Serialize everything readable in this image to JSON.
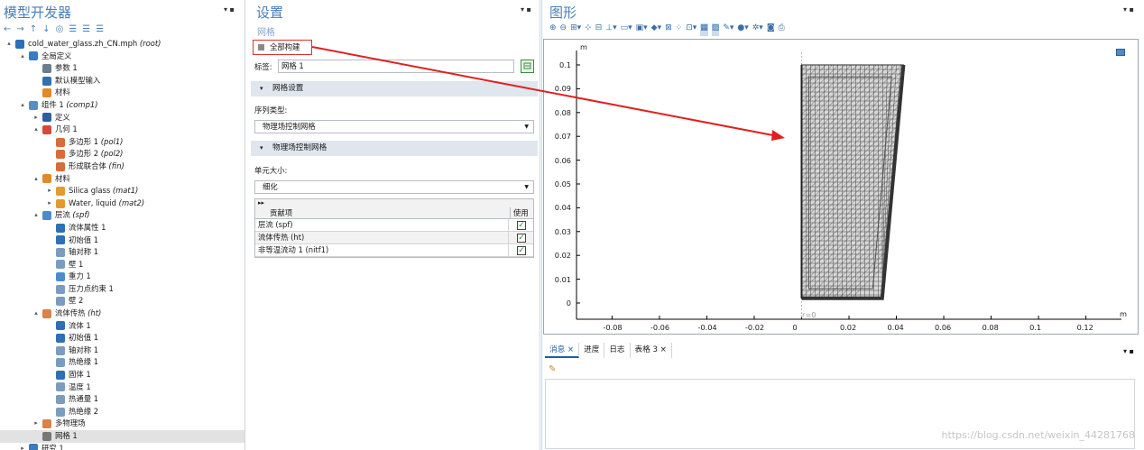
{
  "model_builder": {
    "title": "模型开发器",
    "toolbar": [
      "←",
      "→",
      "↑",
      "↓",
      "◎",
      "☰",
      "☰",
      "☰"
    ],
    "tree": [
      {
        "indent": 0,
        "toggle": "▴",
        "icon": "globe-icon",
        "color": "#2c6fb8",
        "label": "cold_water_glass.zh_CN.mph",
        "tag": "(root)"
      },
      {
        "indent": 1,
        "toggle": "▴",
        "icon": "global-defs-icon",
        "color": "#3a7abf",
        "label": "全局定义",
        "tag": ""
      },
      {
        "indent": 2,
        "toggle": "",
        "icon": "parameters-icon",
        "color": "#6b7c8e",
        "label": "参数 1",
        "tag": ""
      },
      {
        "indent": 2,
        "toggle": "",
        "icon": "model-input-icon",
        "color": "#2f6fb3",
        "label": "默认模型输入",
        "tag": ""
      },
      {
        "indent": 2,
        "toggle": "",
        "icon": "materials-icon",
        "color": "#e08a2a",
        "label": "材料",
        "tag": ""
      },
      {
        "indent": 1,
        "toggle": "▴",
        "icon": "component-icon",
        "color": "#5b8dbd",
        "label": "组件 1",
        "tag": "(comp1)"
      },
      {
        "indent": 2,
        "toggle": "▸",
        "icon": "definitions-icon",
        "color": "#2c5fa0",
        "label": "定义",
        "tag": ""
      },
      {
        "indent": 2,
        "toggle": "▴",
        "icon": "geometry-icon",
        "color": "#d34a3c",
        "label": "几何 1",
        "tag": ""
      },
      {
        "indent": 3,
        "toggle": "",
        "icon": "polygon-icon",
        "color": "#d86b3a",
        "label": "多边形 1",
        "tag": "(pol1)"
      },
      {
        "indent": 3,
        "toggle": "",
        "icon": "polygon-icon",
        "color": "#d86b3a",
        "label": "多边形 2",
        "tag": "(pol2)"
      },
      {
        "indent": 3,
        "toggle": "",
        "icon": "form-union-icon",
        "color": "#d86b3a",
        "label": "形成联合体",
        "tag": "(fin)"
      },
      {
        "indent": 2,
        "toggle": "▴",
        "icon": "materials-icon",
        "color": "#e08a2a",
        "label": "材料",
        "tag": ""
      },
      {
        "indent": 3,
        "toggle": "▸",
        "icon": "material-icon",
        "color": "#e59a2f",
        "label": "Silica glass",
        "tag": "(mat1)"
      },
      {
        "indent": 3,
        "toggle": "▸",
        "icon": "material-icon",
        "color": "#e59a2f",
        "label": "Water, liquid",
        "tag": "(mat2)"
      },
      {
        "indent": 2,
        "toggle": "▴",
        "icon": "laminar-flow-icon",
        "color": "#4d8ccc",
        "label": "层流",
        "tag": "(spf)"
      },
      {
        "indent": 3,
        "toggle": "",
        "icon": "fluid-props-icon",
        "color": "#2f6fb3",
        "label": "流体属性 1",
        "tag": ""
      },
      {
        "indent": 3,
        "toggle": "",
        "icon": "initial-values-icon",
        "color": "#2f6fb3",
        "label": "初始值 1",
        "tag": ""
      },
      {
        "indent": 3,
        "toggle": "",
        "icon": "axial-symmetry-icon",
        "color": "#7b9cbf",
        "label": "轴对称 1",
        "tag": ""
      },
      {
        "indent": 3,
        "toggle": "",
        "icon": "wall-icon",
        "color": "#7b9cbf",
        "label": "壁 1",
        "tag": ""
      },
      {
        "indent": 3,
        "toggle": "",
        "icon": "gravity-icon",
        "color": "#4d8ccc",
        "label": "重力 1",
        "tag": ""
      },
      {
        "indent": 3,
        "toggle": "",
        "icon": "pressure-point-icon",
        "color": "#7b9cbf",
        "label": "压力点约束 1",
        "tag": ""
      },
      {
        "indent": 3,
        "toggle": "",
        "icon": "wall-icon",
        "color": "#7b9cbf",
        "label": "壁 2",
        "tag": ""
      },
      {
        "indent": 2,
        "toggle": "▴",
        "icon": "heat-transfer-icon",
        "color": "#d9834a",
        "label": "流体传热",
        "tag": "(ht)"
      },
      {
        "indent": 3,
        "toggle": "",
        "icon": "fluid-icon",
        "color": "#2f6fb3",
        "label": "流体 1",
        "tag": ""
      },
      {
        "indent": 3,
        "toggle": "",
        "icon": "initial-values-icon",
        "color": "#2f6fb3",
        "label": "初始值 1",
        "tag": ""
      },
      {
        "indent": 3,
        "toggle": "",
        "icon": "axial-symmetry-icon",
        "color": "#7b9cbf",
        "label": "轴对称 1",
        "tag": ""
      },
      {
        "indent": 3,
        "toggle": "",
        "icon": "insulation-icon",
        "color": "#7b9cbf",
        "label": "热绝缘 1",
        "tag": ""
      },
      {
        "indent": 3,
        "toggle": "",
        "icon": "solid-icon",
        "color": "#2f6fb3",
        "label": "固体 1",
        "tag": ""
      },
      {
        "indent": 3,
        "toggle": "",
        "icon": "temperature-icon",
        "color": "#7b9cbf",
        "label": "温度 1",
        "tag": ""
      },
      {
        "indent": 3,
        "toggle": "",
        "icon": "heat-flux-icon",
        "color": "#7b9cbf",
        "label": "热通量 1",
        "tag": ""
      },
      {
        "indent": 3,
        "toggle": "",
        "icon": "insulation-icon",
        "color": "#7b9cbf",
        "label": "热绝缘 2",
        "tag": ""
      },
      {
        "indent": 2,
        "toggle": "▸",
        "icon": "multiphysics-icon",
        "color": "#d9834a",
        "label": "多物理场",
        "tag": ""
      },
      {
        "indent": 2,
        "toggle": "",
        "icon": "mesh-icon",
        "color": "#777777",
        "label": "网格 1",
        "tag": "",
        "selected": true
      },
      {
        "indent": 1,
        "toggle": "▸",
        "icon": "study-icon",
        "color": "#3a7abf",
        "label": "研究 1",
        "tag": ""
      }
    ]
  },
  "settings": {
    "title": "设置",
    "subtitle": "网格",
    "build_all": "全部构建",
    "label_caption": "标签:",
    "label_value": "网格 1",
    "mesh_settings_header": "网格设置",
    "sequence_type_label": "序列类型:",
    "sequence_type_value": "物理场控制网格",
    "physics_mesh_header": "物理场控制网格",
    "element_size_label": "单元大小:",
    "element_size_value": "细化",
    "table": {
      "col_contrib": "贡献项",
      "col_use": "使用",
      "rows": [
        {
          "name": "层流 (spf)",
          "checked": true
        },
        {
          "name": "流体传热 (ht)",
          "checked": true
        },
        {
          "name": "非等温流动 1 (nitf1)",
          "checked": true
        }
      ]
    }
  },
  "graphics": {
    "title": "图形",
    "y_unit": "m",
    "x_unit": "m",
    "origin_label": "r=0",
    "y_ticks": [
      "0.1",
      "0.09",
      "0.08",
      "0.07",
      "0.06",
      "0.05",
      "0.04",
      "0.03",
      "0.02",
      "0.01",
      "0"
    ],
    "x_ticks": [
      "-0.08",
      "-0.06",
      "-0.04",
      "-0.02",
      "0",
      "0.02",
      "0.04",
      "0.06",
      "0.08",
      "0.1",
      "0.12"
    ]
  },
  "messages": {
    "tabs": [
      "消息",
      "进度",
      "日志",
      "表格 3"
    ],
    "watermark": "https://blog.csdn.net/weixin_44281768"
  }
}
